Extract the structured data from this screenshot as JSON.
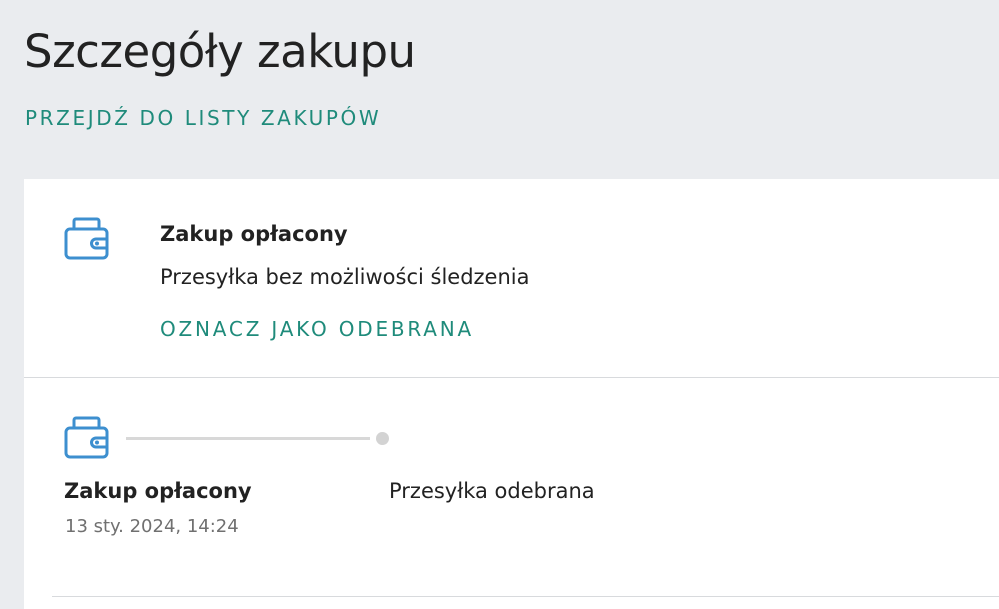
{
  "page": {
    "title": "Szczegóły zakupu",
    "back_link": "PRZEJDŹ DO LISTY ZAKUPÓW"
  },
  "status": {
    "icon": "wallet-icon",
    "title": "Zakup opłacony",
    "subtitle": "Przesyłka bez możliwości śledzenia",
    "action": "OZNACZ JAKO ODEBRANA"
  },
  "timeline": {
    "icon": "wallet-icon",
    "steps": [
      {
        "label": "Zakup opłacony",
        "date": "13 sty. 2024, 14:24",
        "completed": true
      },
      {
        "label": "Przesyłka odebrana",
        "completed": false
      }
    ]
  },
  "colors": {
    "background": "#eaecef",
    "card": "#ffffff",
    "accent": "#1f8b7b",
    "icon": "#3d8fcf",
    "muted_text": "#707070",
    "timeline_track": "#d8d8d8"
  }
}
